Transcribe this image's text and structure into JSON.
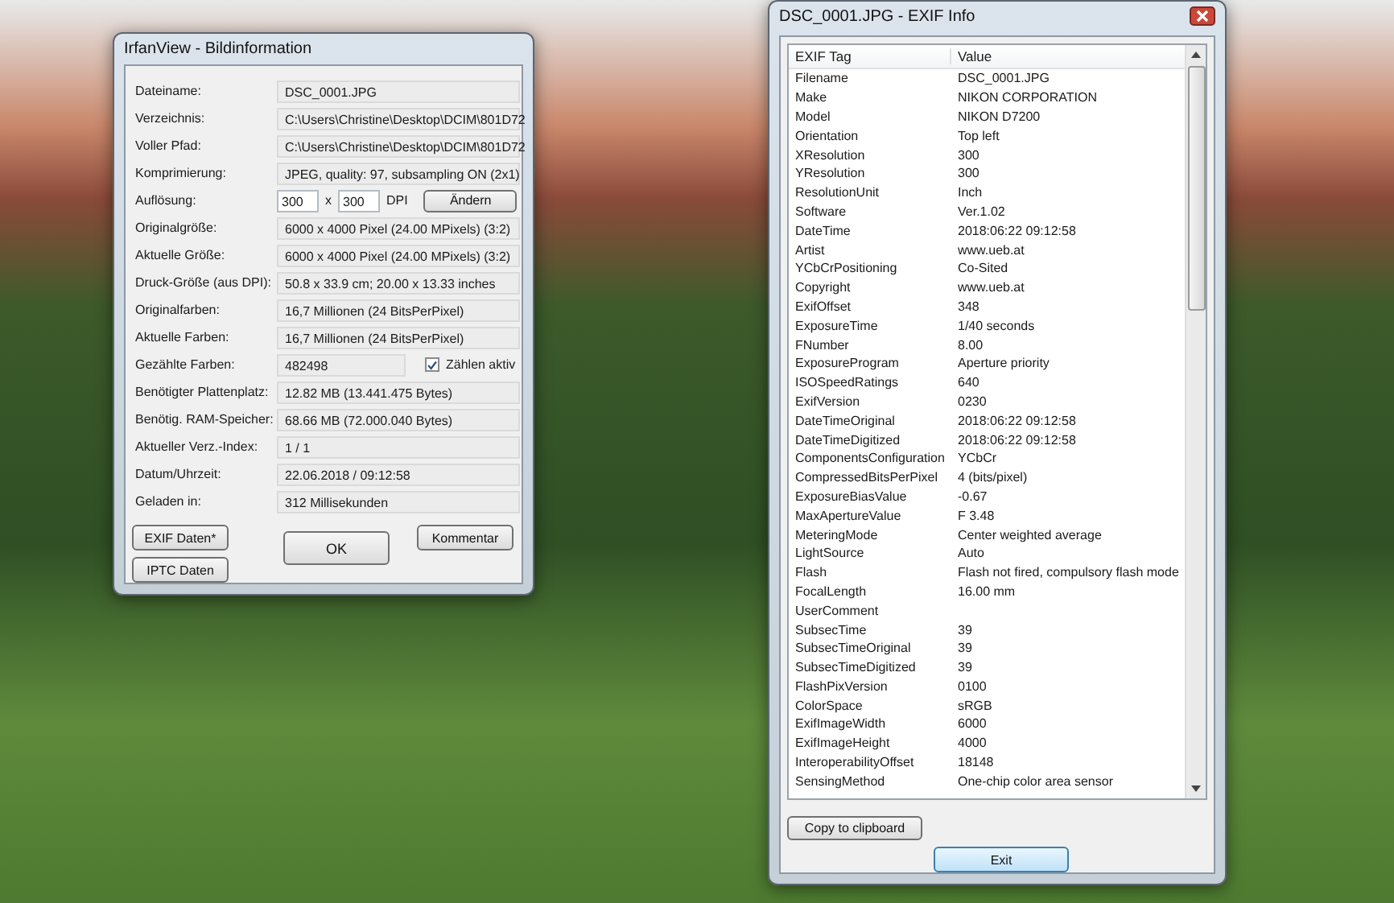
{
  "info_window": {
    "title": "IrfanView - Bildinformation",
    "fields": [
      {
        "kind": "text",
        "label": "Dateiname:",
        "value": "DSC_0001.JPG"
      },
      {
        "kind": "text",
        "label": "Verzeichnis:",
        "value": "C:\\Users\\Christine\\Desktop\\DCIM\\801D72"
      },
      {
        "kind": "text",
        "label": "Voller Pfad:",
        "value": "C:\\Users\\Christine\\Desktop\\DCIM\\801D72"
      },
      {
        "kind": "text",
        "label": "Komprimierung:",
        "value": "JPEG, quality: 97, subsampling ON (2x1)"
      },
      {
        "kind": "resolution",
        "label": "Auflösung:",
        "x_value": "300",
        "separator": "x",
        "y_value": "300",
        "unit": "DPI",
        "button": "Ändern"
      },
      {
        "kind": "text",
        "label": "Originalgröße:",
        "value": "6000 x 4000  Pixel (24.00 MPixels) (3:2)"
      },
      {
        "kind": "text",
        "label": "Aktuelle Größe:",
        "value": "6000 x 4000  Pixel (24.00 MPixels) (3:2)"
      },
      {
        "kind": "text",
        "label": "Druck-Größe (aus DPI):",
        "value": "50.8 x 33.9 cm; 20.00 x 13.33 inches"
      },
      {
        "kind": "text",
        "label": "Originalfarben:",
        "value": "16,7 Millionen   (24 BitsPerPixel)"
      },
      {
        "kind": "text",
        "label": "Aktuelle Farben:",
        "value": "16,7 Millionen   (24 BitsPerPixel)"
      },
      {
        "kind": "count",
        "label": "Gezählte Farben:",
        "value": "482498",
        "checkbox_label": "Zählen aktiv",
        "checked": true
      },
      {
        "kind": "text",
        "label": "Benötigter Plattenplatz:",
        "value": "12.82 MB (13.441.475 Bytes)"
      },
      {
        "kind": "text",
        "label": "Benötig. RAM-Speicher:",
        "value": "68.66  MB (72.000.040 Bytes)"
      },
      {
        "kind": "text",
        "label": "Aktueller Verz.-Index:",
        "value": "1  /  1"
      },
      {
        "kind": "text",
        "label": "Datum/Uhrzeit:",
        "value": "22.06.2018 / 09:12:58"
      },
      {
        "kind": "text",
        "label": "Geladen in:",
        "value": "312 Millisekunden"
      }
    ],
    "buttons": {
      "exif": "EXIF Daten*",
      "iptc": "IPTC Daten",
      "ok": "OK",
      "comment": "Kommentar"
    }
  },
  "exif_window": {
    "title": "DSC_0001.JPG - EXIF Info",
    "table": {
      "columns": [
        "EXIF Tag",
        "Value"
      ],
      "rows": [
        [
          "Filename",
          "DSC_0001.JPG"
        ],
        [
          "Make",
          "NIKON CORPORATION"
        ],
        [
          "Model",
          "NIKON D7200"
        ],
        [
          "Orientation",
          "Top left"
        ],
        [
          "XResolution",
          "300"
        ],
        [
          "YResolution",
          "300"
        ],
        [
          "ResolutionUnit",
          "Inch"
        ],
        [
          "Software",
          "Ver.1.02"
        ],
        [
          "DateTime",
          "2018:06:22 09:12:58"
        ],
        [
          "Artist",
          "www.ueb.at"
        ],
        [
          "YCbCrPositioning",
          "Co-Sited"
        ],
        [
          "Copyright",
          "www.ueb.at"
        ],
        [
          "ExifOffset",
          "348"
        ],
        [
          "ExposureTime",
          "1/40 seconds"
        ],
        [
          "FNumber",
          "8.00"
        ],
        [
          "ExposureProgram",
          "Aperture priority"
        ],
        [
          "ISOSpeedRatings",
          "640"
        ],
        [
          "ExifVersion",
          "0230"
        ],
        [
          "DateTimeOriginal",
          "2018:06:22 09:12:58"
        ],
        [
          "DateTimeDigitized",
          "2018:06:22 09:12:58"
        ],
        [
          "ComponentsConfiguration",
          "YCbCr"
        ],
        [
          "CompressedBitsPerPixel",
          "4 (bits/pixel)"
        ],
        [
          "ExposureBiasValue",
          "-0.67"
        ],
        [
          "MaxApertureValue",
          "F 3.48"
        ],
        [
          "MeteringMode",
          "Center weighted average"
        ],
        [
          "LightSource",
          "Auto"
        ],
        [
          "Flash",
          "Flash not fired, compulsory flash mode"
        ],
        [
          "FocalLength",
          "16.00 mm"
        ],
        [
          "UserComment",
          ""
        ],
        [
          "SubsecTime",
          "39"
        ],
        [
          "SubsecTimeOriginal",
          "39"
        ],
        [
          "SubsecTimeDigitized",
          "39"
        ],
        [
          "FlashPixVersion",
          "0100"
        ],
        [
          "ColorSpace",
          "sRGB"
        ],
        [
          "ExifImageWidth",
          "6000"
        ],
        [
          "ExifImageHeight",
          "4000"
        ],
        [
          "InteroperabilityOffset",
          "18148"
        ],
        [
          "SensingMethod",
          "One-chip color area sensor"
        ]
      ]
    },
    "buttons": {
      "copy": "Copy to clipboard",
      "exit": "Exit"
    }
  }
}
